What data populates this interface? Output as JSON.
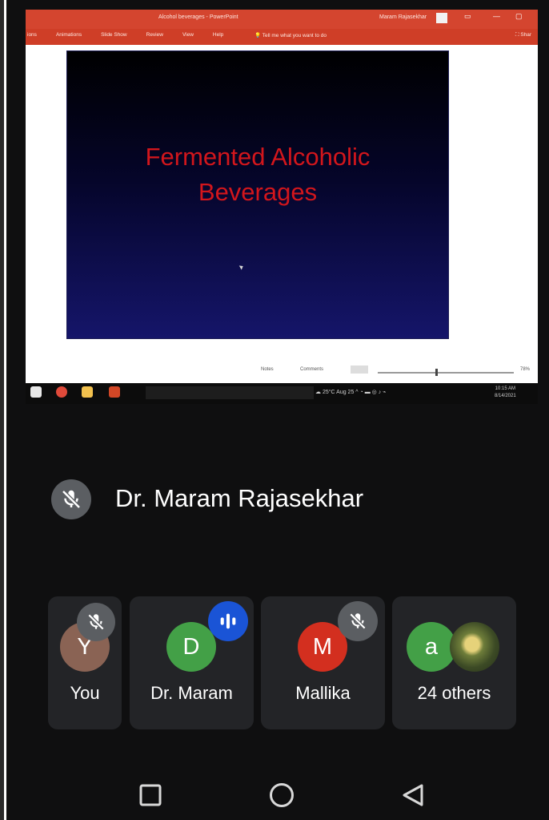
{
  "shared_screen": {
    "window_title": "Alcohol beverages - PowerPoint",
    "user": "Maram Rajasekhar",
    "window_buttons": [
      "▭",
      "—",
      "▢"
    ],
    "ribbon_tabs": [
      "ions",
      "Animations",
      "Slide Show",
      "Review",
      "View",
      "Help"
    ],
    "tell_me": "Tell me what you want to do",
    "share_label": "Shar",
    "slide": {
      "title_line1": "Fermented Alcoholic",
      "title_line2": "Beverages"
    },
    "status_bar": {
      "notes_label": "Notes",
      "comments_label": "Comments",
      "zoom": "78%"
    },
    "taskbar": {
      "weather": "25°C  Aug 25",
      "time": "10:15 AM",
      "date": "8/14/2021"
    }
  },
  "presenter": {
    "name": "Dr. Maram Rajasekhar",
    "mic_icon": "mic-off-icon"
  },
  "participants": [
    {
      "initial": "Y",
      "name": "You",
      "avatar_color": "#8a6354",
      "status": "muted"
    },
    {
      "initial": "D",
      "name": "Dr. Maram",
      "avatar_color": "#43a047",
      "status": "speaking"
    },
    {
      "initial": "M",
      "name": "Mallika",
      "avatar_color": "#d32f1f",
      "status": "muted"
    },
    {
      "initial": "a",
      "name": "24 others",
      "avatar_color": "#43a047",
      "status": "none"
    }
  ],
  "nav_bar": {
    "recents_icon": "recents-square-icon",
    "home_icon": "home-circle-icon",
    "back_icon": "back-triangle-icon"
  }
}
